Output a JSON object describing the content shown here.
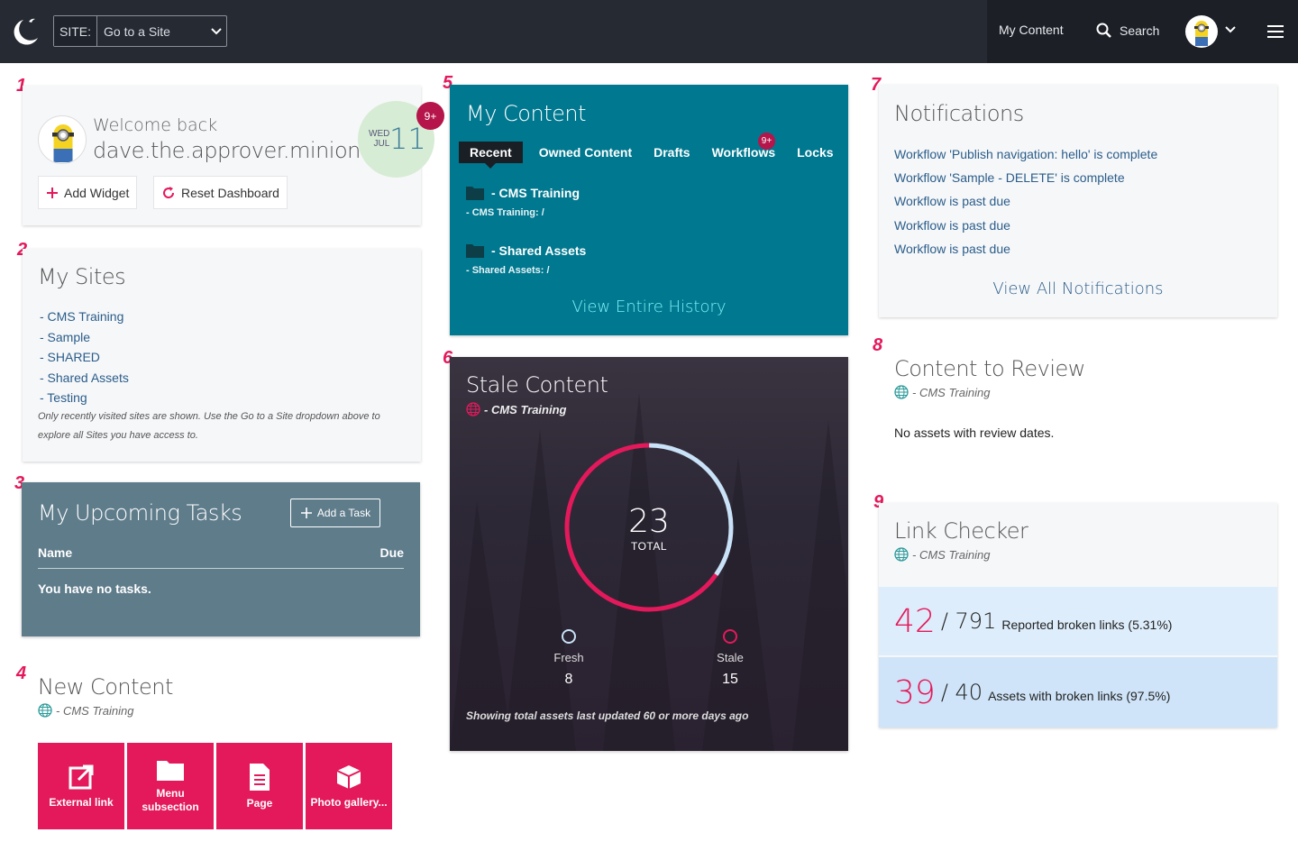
{
  "topbar": {
    "site_label": "SITE:",
    "site_value": "Go to a Site",
    "my_content": "My Content",
    "search": "Search"
  },
  "widget_numbers": [
    "1",
    "2",
    "3",
    "4",
    "5",
    "6",
    "7",
    "8",
    "9"
  ],
  "welcome": {
    "greeting": "Welcome back",
    "username": "dave.the.approver.minion",
    "day_of_week": "WED",
    "month": "JUL",
    "day": "11",
    "badge": "9+",
    "add_widget": "Add Widget",
    "reset_dashboard": "Reset Dashboard"
  },
  "my_sites": {
    "title": "My Sites",
    "items": [
      "- CMS Training",
      "- Sample",
      "- SHARED",
      "- Shared Assets",
      "- Testing"
    ],
    "note": "Only recently visited sites are shown. Use the Go to a Site dropdown above to explore all Sites you have access to."
  },
  "tasks": {
    "title": "My Upcoming Tasks",
    "add_task": "Add a Task",
    "col_name": "Name",
    "col_due": "Due",
    "empty": "You have no tasks."
  },
  "new_content": {
    "title": "New Content",
    "site": "- CMS Training",
    "tiles": [
      {
        "label": "External link",
        "icon": "external-link-icon"
      },
      {
        "label": "Menu subsection",
        "icon": "folder-icon"
      },
      {
        "label": "Page",
        "icon": "page-icon"
      },
      {
        "label": "Photo gallery...",
        "icon": "box-icon"
      }
    ]
  },
  "my_content": {
    "title": "My Content",
    "tabs": [
      "Recent",
      "Owned Content",
      "Drafts",
      "Workflows",
      "Locks"
    ],
    "workflows_badge": "9+",
    "items": [
      {
        "title": "- CMS Training",
        "path": "- CMS Training: /"
      },
      {
        "title": "- Shared Assets",
        "path": "- Shared Assets: /"
      }
    ],
    "history": "View Entire History"
  },
  "stale": {
    "title": "Stale Content",
    "site": "- CMS Training",
    "total": "23",
    "total_label": "TOTAL",
    "fresh_label": "Fresh",
    "fresh_value": "8",
    "stale_label": "Stale",
    "stale_value": "15",
    "footnote": "Showing total assets last updated 60 or more days ago",
    "colors": {
      "stale": "#e4195b",
      "fresh": "#c9e2f7"
    }
  },
  "notifications": {
    "title": "Notifications",
    "items": [
      "Workflow 'Publish navigation: hello' is complete",
      "Workflow 'Sample - DELETE' is complete",
      "Workflow is past due",
      "Workflow is past due",
      "Workflow is past due"
    ],
    "view_all": "View All Notifications"
  },
  "review": {
    "title": "Content to Review",
    "site": "- CMS Training",
    "empty": "No assets with review dates."
  },
  "link_checker": {
    "title": "Link Checker",
    "site": "- CMS Training",
    "rows": [
      {
        "count": "42",
        "total": "/ 791",
        "label": "Reported broken links (5.31%)"
      },
      {
        "count": "39",
        "total": "/ 40",
        "label": "Assets with broken links (97.5%)"
      }
    ]
  }
}
